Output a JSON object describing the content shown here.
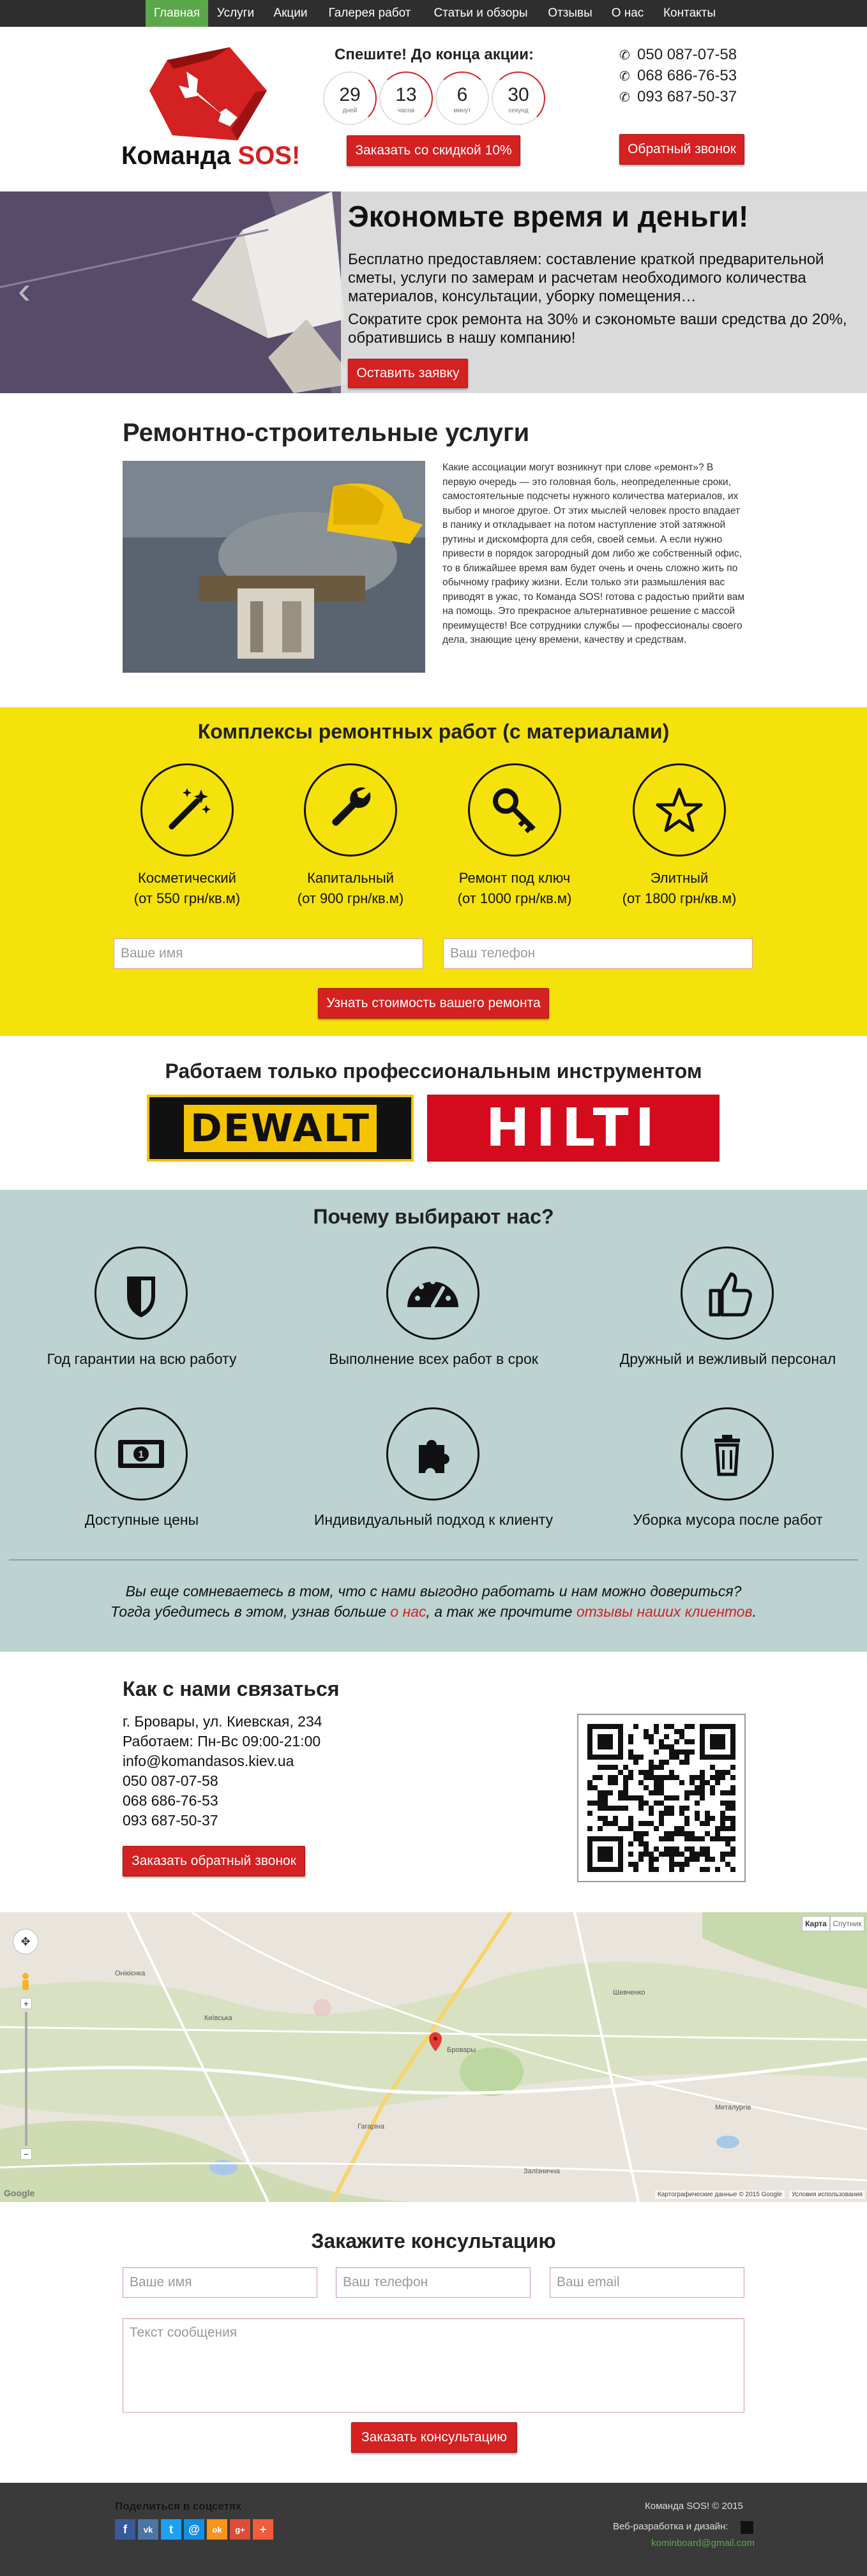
{
  "nav": {
    "items": [
      {
        "label": "Главная",
        "active": true
      },
      {
        "label": "Услуги"
      },
      {
        "label": "Акции"
      },
      {
        "label": "Галерея работ"
      },
      {
        "label": "Статьи и обзоры"
      },
      {
        "label": "Отзывы"
      },
      {
        "label": "О нас"
      },
      {
        "label": "Контакты"
      }
    ]
  },
  "header": {
    "logo_text": "Команда ",
    "logo_text_accent": "SOS!",
    "promo_title": "Спешите! До конца акции:",
    "countdown": [
      {
        "value": "29",
        "unit": "дней"
      },
      {
        "value": "13",
        "unit": "часов"
      },
      {
        "value": "6",
        "unit": "минут"
      },
      {
        "value": "30",
        "unit": "секунд"
      }
    ],
    "discount_button": "Заказать со скидкой 10%",
    "phones": [
      "050  087-07-58",
      "068  686-76-53",
      "093  687-50-37"
    ],
    "callback_button": "Обратный звонок"
  },
  "slider": {
    "heading": "Экономьте время и деньги!",
    "paragraph1": "Бесплатно предоставляем: составление краткой предварительной сметы, услуги по замерам и расчетам необходимого количества материалов, консультации, уборку помещения…",
    "paragraph2": "Сократите срок ремонта на 30% и сэкономьте ваши средства до 20%, обратившись в нашу компанию!",
    "button": "Оставить заявку"
  },
  "services": {
    "title": "Ремонтно-строительные услуги",
    "text": "Какие ассоциации могут возникнут при слове «ремонт»? В первую очередь — это головная боль, неопределенные сроки, самостоятельные подсчеты нужного количества материалов, их выбор и многое другое. От этих мыслей человек просто впадает в панику и откладывает на потом наступление этой затяжной рутины и дискомфорта для себя, своей семьи. А если нужно привести в порядок загородный дом либо же собственный офис, то в ближайшее время вам будет очень и очень сложно жить по обычному графику жизни. Если только эти размышления вас приводят в ужас, то Команда SOS! готова с радостью прийти вам на помощь. Это прекрасное альтернативное решение с массой преимуществ! Все сотрудники службы — профессионалы своего дела, знающие цену времени, качеству и средствам."
  },
  "complexes": {
    "title": "Комплексы ремонтных работ (с материалами)",
    "items": [
      {
        "name": "Косметический",
        "price": "(от 550 грн/кв.м)",
        "icon": "magic-wand-icon"
      },
      {
        "name": "Капитальный",
        "price": "(от 900 грн/кв.м)",
        "icon": "wrench-icon"
      },
      {
        "name": "Ремонт под ключ",
        "price": "(от 1000 грн/кв.м)",
        "icon": "key-icon"
      },
      {
        "name": "Элитный",
        "price": "(от 1800 грн/кв.м)",
        "icon": "star-icon"
      }
    ],
    "name_placeholder": "Ваше имя",
    "phone_placeholder": "Ваш телефон",
    "button": "Узнать стоимость вашего ремонта"
  },
  "tools": {
    "title": "Работаем только профессиональным инструментом",
    "brands": [
      "DEWALT",
      "HILTI"
    ]
  },
  "why": {
    "title": "Почему выбирают нас?",
    "items": [
      {
        "label": "Год гарантии на всю работу",
        "icon": "shield-icon"
      },
      {
        "label": "Выполнение всех работ в срок",
        "icon": "speedometer-icon"
      },
      {
        "label": "Дружный и вежливый персонал",
        "icon": "thumbs-up-icon"
      },
      {
        "label": "Доступные цены",
        "icon": "banknote-icon"
      },
      {
        "label": "Индивидуальный подход к клиенту",
        "icon": "puzzle-icon"
      },
      {
        "label": "Уборка мусора после работ",
        "icon": "trash-icon"
      }
    ],
    "note_line1": "Вы еще сомневаетесь в том, что с нами выгодно работать и нам можно довериться?",
    "note_line2_before": "Тогда убедитесь в этом, узнав больше ",
    "note_link1": "о нас",
    "note_line2_middle": ", а так же прочтите ",
    "note_link2": "отзывы наших клиентов",
    "note_line2_after": "."
  },
  "contacts": {
    "title": "Как с нами связаться",
    "address": "г. Бровары, ул. Киевская, 234",
    "hours": "Работаем: Пн-Вс 09:00-21:00",
    "email": "info@komandasos.kiev.ua",
    "phones": [
      "050 087-07-58",
      "068 686-76-53",
      "093 687-50-37"
    ],
    "button": "Заказать обратный звонок"
  },
  "map": {
    "map_type": "Карта",
    "satellite_type": "Спутник",
    "attribution": "Картографические данные © 2015 Google",
    "terms": "Условия использования",
    "google": "Google",
    "streets": [
      "Бровары",
      "Київська",
      "Гагаріна",
      "Шевченко",
      "Металургів",
      "Онікієнка",
      "Залізнична"
    ]
  },
  "consult": {
    "title": "Закажите консультацию",
    "name_placeholder": "Ваше имя",
    "phone_placeholder": "Ваш телефон",
    "email_placeholder": "Ваш email",
    "message_placeholder": "Текст сообщения",
    "button": "Заказать консультацию"
  },
  "footer": {
    "share_label": "Поделиться в соцсетях",
    "socials": [
      {
        "name": "facebook-icon",
        "glyph": "f",
        "color": "#3b5998"
      },
      {
        "name": "vk-icon",
        "glyph": "vk",
        "color": "#4c75a3"
      },
      {
        "name": "twitter-icon",
        "glyph": "t",
        "color": "#1da1f2"
      },
      {
        "name": "moimir-icon",
        "glyph": "@",
        "color": "#168de2"
      },
      {
        "name": "odnoklassniki-icon",
        "glyph": "ok",
        "color": "#f7931e"
      },
      {
        "name": "googleplus-icon",
        "glyph": "g+",
        "color": "#dd4b39"
      },
      {
        "name": "more-share-icon",
        "glyph": "+",
        "color": "#f25c3a"
      }
    ],
    "copyright": "Команда SOS! © 2015",
    "dev": "Веб-разработка и дизайн:",
    "dev_link": "kominboard@gmail.com"
  }
}
